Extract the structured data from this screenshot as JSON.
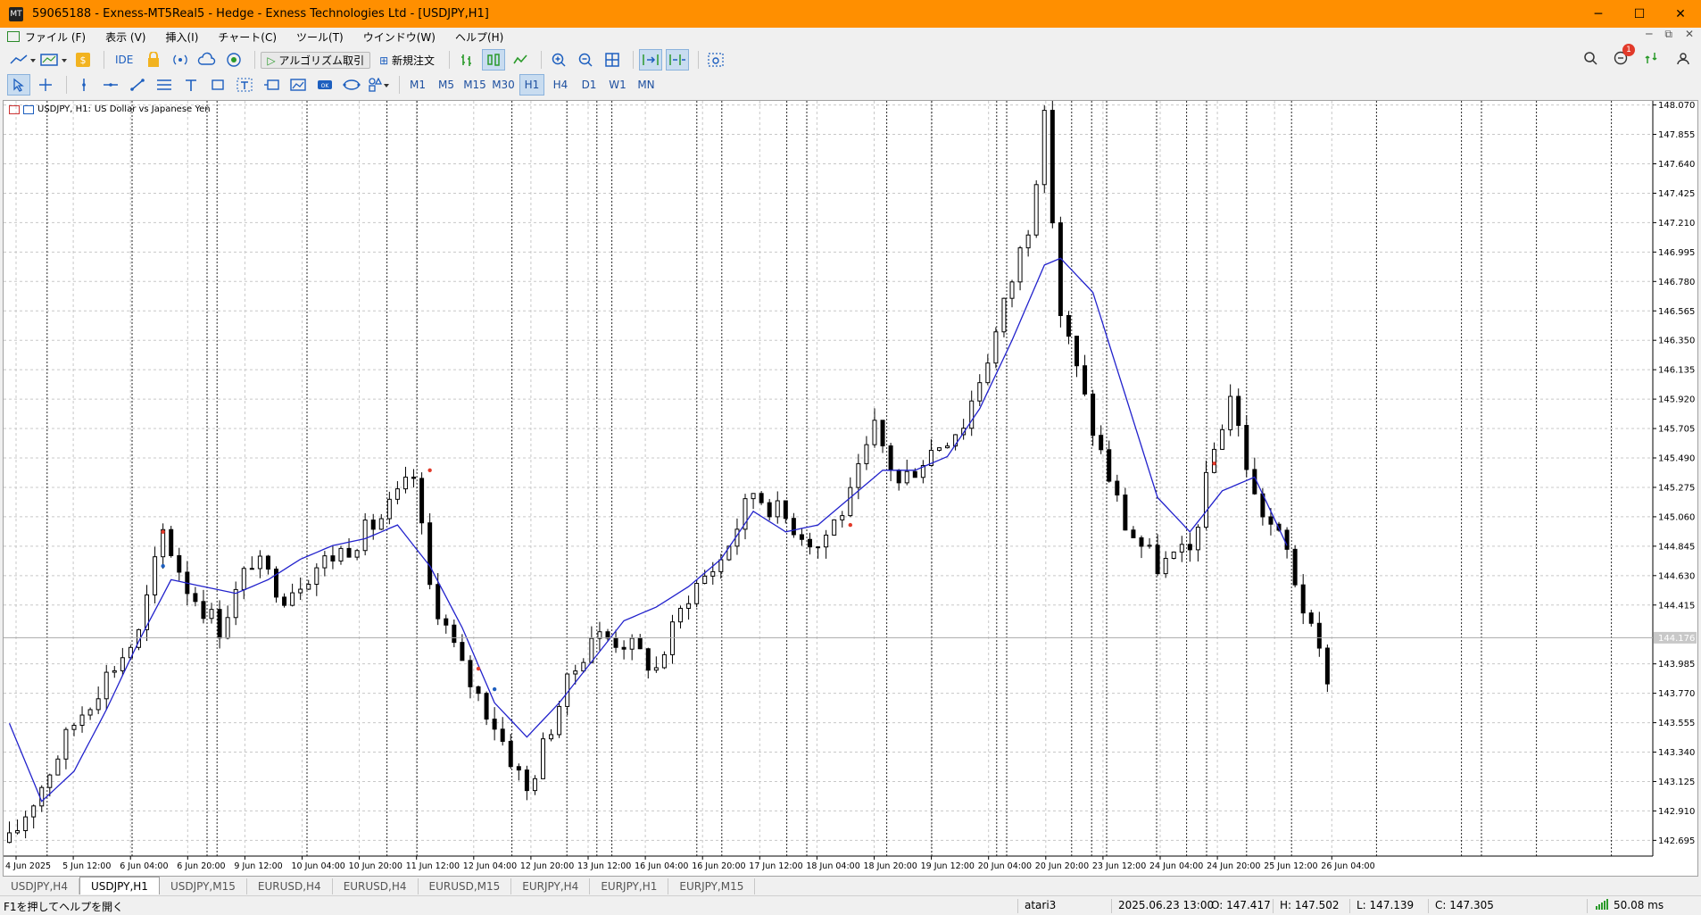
{
  "window": {
    "title": "59065188 - Exness-MT5Real5 - Hedge - Exness Technologies Ltd - [USDJPY,H1]",
    "controls": [
      "─",
      "☐",
      "✕"
    ]
  },
  "menu": {
    "items": [
      "ファイル (F)",
      "表示 (V)",
      "挿入(I)",
      "チャート(C)",
      "ツール(T)",
      "ウインドウ(W)",
      "ヘルプ(H)"
    ],
    "mdi_controls": [
      "─",
      "⧉",
      "✕"
    ]
  },
  "toolbar": {
    "ide_label": "IDE",
    "algo_label": "アルゴリズム取引",
    "new_order_label": "新規注文",
    "notification_count": "1"
  },
  "timeframes": {
    "items": [
      "M1",
      "M5",
      "M15",
      "M30",
      "H1",
      "H4",
      "D1",
      "W1",
      "MN"
    ],
    "active": "H1"
  },
  "chart_label": {
    "symbol": "USDJPY, H1:",
    "description": "US Dollar vs Japanese Yen"
  },
  "chart_data": {
    "type": "candlestick",
    "symbol": "USDJPY",
    "timeframe": "H1",
    "y_ticks": [
      "148.070",
      "147.855",
      "147.640",
      "147.425",
      "147.210",
      "146.995",
      "146.780",
      "146.565",
      "146.350",
      "146.135",
      "145.920",
      "145.705",
      "145.490",
      "145.275",
      "145.060",
      "144.845",
      "144.630",
      "144.415",
      "144.176",
      "143.985",
      "143.770",
      "143.555",
      "143.340",
      "143.125",
      "142.910",
      "142.695"
    ],
    "ylim": [
      142.58,
      148.1
    ],
    "current_price": "144.176",
    "x_ticks": [
      "4 Jun 2025",
      "5 Jun 12:00",
      "6 Jun 04:00",
      "6 Jun 20:00",
      "9 Jun 12:00",
      "10 Jun 04:00",
      "10 Jun 20:00",
      "11 Jun 12:00",
      "12 Jun 04:00",
      "12 Jun 20:00",
      "13 Jun 12:00",
      "16 Jun 04:00",
      "16 Jun 20:00",
      "17 Jun 12:00",
      "18 Jun 04:00",
      "18 Jun 20:00",
      "19 Jun 12:00",
      "20 Jun 04:00",
      "20 Jun 20:00",
      "23 Jun 12:00",
      "24 Jun 04:00",
      "24 Jun 20:00",
      "25 Jun 12:00",
      "26 Jun 04:00"
    ],
    "close_path": [
      [
        0,
        142.68
      ],
      [
        4,
        143.1
      ],
      [
        8,
        143.55
      ],
      [
        12,
        143.9
      ],
      [
        16,
        144.2
      ],
      [
        19,
        144.95
      ],
      [
        22,
        144.55
      ],
      [
        26,
        144.25
      ],
      [
        30,
        144.75
      ],
      [
        34,
        144.5
      ],
      [
        38,
        144.7
      ],
      [
        42,
        144.85
      ],
      [
        46,
        145.05
      ],
      [
        50,
        145.35
      ],
      [
        52,
        144.55
      ],
      [
        56,
        143.95
      ],
      [
        60,
        143.55
      ],
      [
        64,
        143.05
      ],
      [
        68,
        143.7
      ],
      [
        72,
        144.2
      ],
      [
        76,
        144.15
      ],
      [
        80,
        143.95
      ],
      [
        84,
        144.5
      ],
      [
        88,
        144.75
      ],
      [
        92,
        145.25
      ],
      [
        96,
        145.05
      ],
      [
        100,
        144.85
      ],
      [
        104,
        145.2
      ],
      [
        107,
        145.7
      ],
      [
        110,
        145.3
      ],
      [
        114,
        145.55
      ],
      [
        118,
        145.75
      ],
      [
        122,
        146.4
      ],
      [
        126,
        147.2
      ],
      [
        128,
        147.95
      ],
      [
        130,
        146.55
      ],
      [
        134,
        145.7
      ],
      [
        138,
        145.0
      ],
      [
        142,
        144.7
      ],
      [
        146,
        144.8
      ],
      [
        149,
        145.55
      ],
      [
        151,
        145.95
      ],
      [
        154,
        145.2
      ],
      [
        158,
        144.8
      ],
      [
        161,
        144.2
      ],
      [
        163,
        143.9
      ]
    ],
    "ma_line": [
      [
        0,
        143.55
      ],
      [
        4,
        142.98
      ],
      [
        8,
        143.2
      ],
      [
        12,
        143.65
      ],
      [
        16,
        144.15
      ],
      [
        20,
        144.6
      ],
      [
        24,
        144.55
      ],
      [
        28,
        144.5
      ],
      [
        32,
        144.6
      ],
      [
        36,
        144.75
      ],
      [
        40,
        144.85
      ],
      [
        44,
        144.9
      ],
      [
        48,
        145.0
      ],
      [
        52,
        144.7
      ],
      [
        56,
        144.25
      ],
      [
        60,
        143.7
      ],
      [
        64,
        143.45
      ],
      [
        68,
        143.7
      ],
      [
        72,
        144.0
      ],
      [
        76,
        144.3
      ],
      [
        80,
        144.4
      ],
      [
        84,
        144.55
      ],
      [
        88,
        144.75
      ],
      [
        92,
        145.1
      ],
      [
        96,
        144.95
      ],
      [
        100,
        145.0
      ],
      [
        104,
        145.2
      ],
      [
        108,
        145.4
      ],
      [
        112,
        145.4
      ],
      [
        116,
        145.5
      ],
      [
        120,
        145.85
      ],
      [
        124,
        146.35
      ],
      [
        128,
        146.9
      ],
      [
        130,
        146.95
      ],
      [
        134,
        146.7
      ],
      [
        138,
        145.95
      ],
      [
        142,
        145.2
      ],
      [
        146,
        144.95
      ],
      [
        150,
        145.25
      ],
      [
        154,
        145.35
      ],
      [
        158,
        144.85
      ]
    ],
    "grid": true
  },
  "tabs": {
    "items": [
      "USDJPY,H4",
      "USDJPY,H1",
      "USDJPY,M15",
      "EURUSD,H4",
      "EURUSD,H4",
      "EURUSD,M15",
      "EURJPY,H4",
      "EURJPY,H1",
      "EURJPY,M15"
    ],
    "active_index": 1
  },
  "status": {
    "help": "F1を押してヘルプを開く",
    "profile": "atari3",
    "datetime": "2025.06.23 13:00",
    "open": "O: 147.417",
    "high": "H: 147.502",
    "low": "L: 147.139",
    "close": "C: 147.305",
    "ping": "50.08 ms"
  }
}
